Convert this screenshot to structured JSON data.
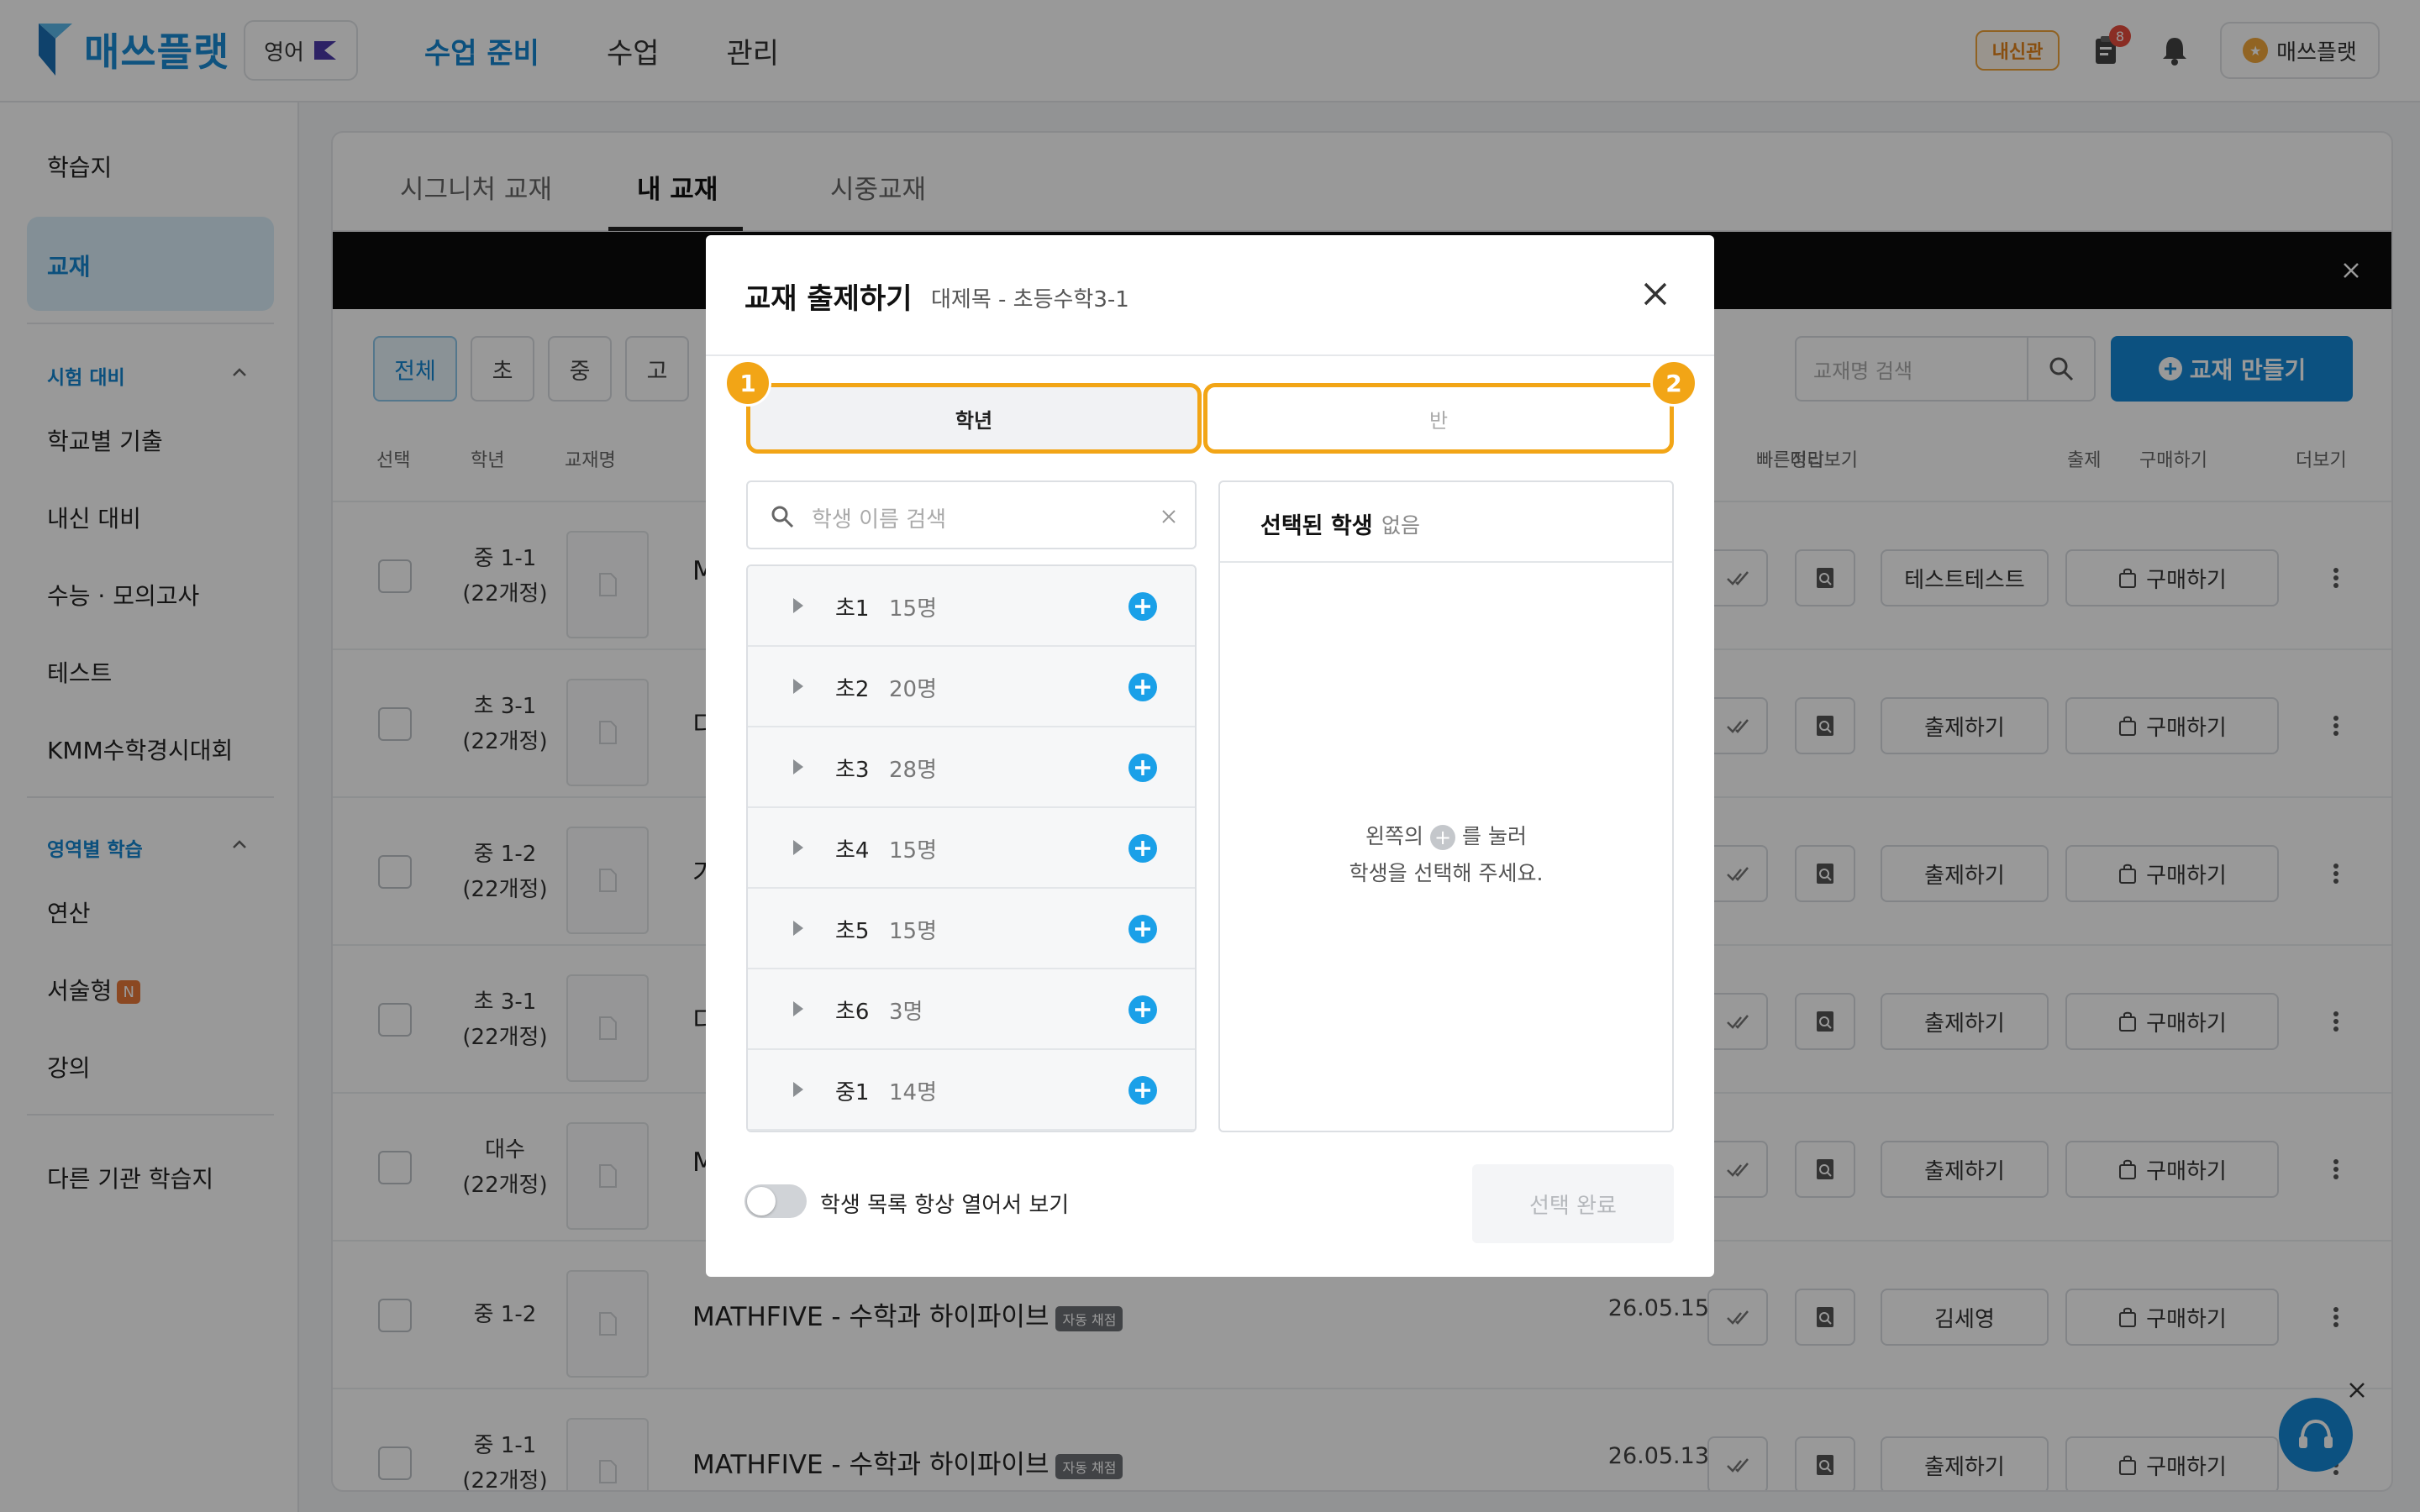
{
  "header": {
    "logo_text": "매쓰플랫",
    "subject": "영어",
    "nav": [
      "수업 준비",
      "수업",
      "관리"
    ],
    "badge": "내신관",
    "notification_count": "8",
    "user": "매쓰플랫"
  },
  "sidebar": {
    "worksheet": "학습지",
    "textbook": "교재",
    "exam_section": "시험 대비",
    "exam_items": [
      "학교별 기출",
      "내신 대비",
      "수능 · 모의고사",
      "테스트",
      "KMM수학경시대회"
    ],
    "area_section": "영역별 학습",
    "area_items": [
      "연산",
      "서술형",
      "강의"
    ],
    "new_badge": "N",
    "other": "다른 기관 학습지"
  },
  "main": {
    "tabs": [
      "시그니처 교재",
      "내 교재",
      "시중교재"
    ],
    "filters": [
      "전체",
      "초",
      "중",
      "고"
    ],
    "search_placeholder": "교재명 검색",
    "create_button": "교재 만들기",
    "columns": {
      "select": "선택",
      "grade": "학년",
      "name": "교재명",
      "answer": "빠른정답",
      "preview": "미리보기",
      "assign": "출제",
      "buy": "구매하기",
      "more": "더보기"
    },
    "rows": [
      {
        "grade1": "중 1-1",
        "grade2": "(22개정)",
        "name": "M",
        "tag": "",
        "date": "",
        "assign": "테스트테스트",
        "buy": "구매하기"
      },
      {
        "grade1": "초 3-1",
        "grade2": "(22개정)",
        "name": "디",
        "tag": "",
        "date": "",
        "assign": "출제하기",
        "buy": "구매하기"
      },
      {
        "grade1": "중 1-2",
        "grade2": "(22개정)",
        "name": "기",
        "tag": "",
        "date": "",
        "assign": "출제하기",
        "buy": "구매하기"
      },
      {
        "grade1": "초 3-1",
        "grade2": "(22개정)",
        "name": "디",
        "tag": "",
        "date": "",
        "assign": "출제하기",
        "buy": "구매하기"
      },
      {
        "grade1": "대수",
        "grade2": "(22개정)",
        "name": "M",
        "tag": "",
        "date": "",
        "assign": "출제하기",
        "buy": "구매하기"
      },
      {
        "grade1": "중 1-2",
        "grade2": "",
        "name": "MATHFIVE - 수학과 하이파이브",
        "tag": "자동 채점",
        "date": "26.05.15",
        "assign": "김세영",
        "buy": "구매하기"
      },
      {
        "grade1": "중 1-1",
        "grade2": "(22개정)",
        "name": "MATHFIVE - 수학과 하이파이브",
        "tag": "자동 채점",
        "date": "26.05.13",
        "assign": "출제하기",
        "buy": "구매하기"
      }
    ]
  },
  "modal": {
    "title": "교재 출제하기",
    "subtitle": "대제목 - 초등수학3-1",
    "tab_grade": "학년",
    "tab_class": "반",
    "step1": "1",
    "step2": "2",
    "search_placeholder": "학생 이름 검색",
    "grades": [
      {
        "name": "초1",
        "count": "15명"
      },
      {
        "name": "초2",
        "count": "20명"
      },
      {
        "name": "초3",
        "count": "28명"
      },
      {
        "name": "초4",
        "count": "15명"
      },
      {
        "name": "초5",
        "count": "15명"
      },
      {
        "name": "초6",
        "count": "3명"
      },
      {
        "name": "중1",
        "count": "14명"
      }
    ],
    "selected_title": "선택된 학생",
    "selected_none": "없음",
    "help_line1_prefix": "왼쪽의",
    "help_line1_suffix": "를 눌러",
    "help_line2": "학생을 선택해 주세요.",
    "toggle_label": "학생 목록 항상 열어서 보기",
    "done_button": "선택 완료"
  },
  "colors": {
    "brand": "#1588d6",
    "highlight": "#f2a516",
    "plus": "#1aa0e8"
  }
}
